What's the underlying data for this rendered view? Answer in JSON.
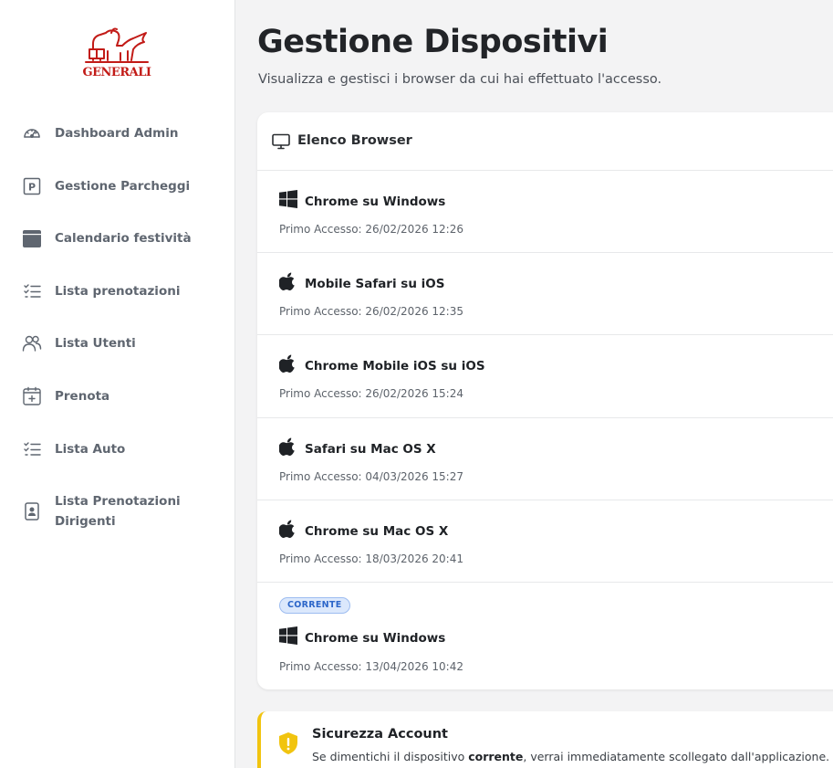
{
  "brand": {
    "logo_text": "GENERALI",
    "color": "#c21b17"
  },
  "sidebar": {
    "items": [
      {
        "label": "Dashboard Admin",
        "icon": "gauge-icon"
      },
      {
        "label": "Gestione Parcheggi",
        "icon": "parking-icon"
      },
      {
        "label": "Calendario festività",
        "icon": "calendar-icon"
      },
      {
        "label": "Lista prenotazioni",
        "icon": "checklist-icon"
      },
      {
        "label": "Lista Utenti",
        "icon": "users-icon"
      },
      {
        "label": "Prenota",
        "icon": "calendar-plus-icon"
      },
      {
        "label": "Lista Auto",
        "icon": "checklist-icon"
      },
      {
        "label": "Lista Prenotazioni Dirigenti",
        "label_line1": "Lista Prenotazioni",
        "label_line2": "Dirigenti",
        "icon": "id-badge-icon"
      }
    ]
  },
  "page": {
    "title": "Gestione Dispositivi",
    "subtitle": "Visualizza e gestisci i browser da cui hai effettuato l'accesso."
  },
  "browsers_card": {
    "title": "Elenco Browser",
    "icon": "monitor-icon",
    "devices": [
      {
        "name": "Chrome su Windows",
        "os_icon": "windows-icon",
        "first_access": "Primo Accesso: 26/02/2026 12:26"
      },
      {
        "name": "Mobile Safari su iOS",
        "os_icon": "apple-icon",
        "first_access": "Primo Accesso: 26/02/2026 12:35"
      },
      {
        "name": "Chrome Mobile iOS su iOS",
        "os_icon": "apple-icon",
        "first_access": "Primo Accesso: 26/02/2026 15:24"
      },
      {
        "name": "Safari su Mac OS X",
        "os_icon": "apple-icon",
        "first_access": "Primo Accesso: 04/03/2026 15:27"
      },
      {
        "name": "Chrome su Mac OS X",
        "os_icon": "apple-icon",
        "first_access": "Primo Accesso: 18/03/2026 20:41"
      },
      {
        "name": "Chrome su Windows",
        "os_icon": "windows-icon",
        "first_access": "Primo Accesso: 13/04/2026 10:42",
        "badge": "CORRENTE"
      }
    ]
  },
  "security_alert": {
    "title": "Sicurezza Account",
    "icon": "shield-warning-icon",
    "text_before": "Se dimentichi il dispositivo ",
    "text_bold": "corrente",
    "text_after": ", verrai immediatamente scollegato dall'applicazione. Ri",
    "accent_color": "#f1c40f"
  }
}
